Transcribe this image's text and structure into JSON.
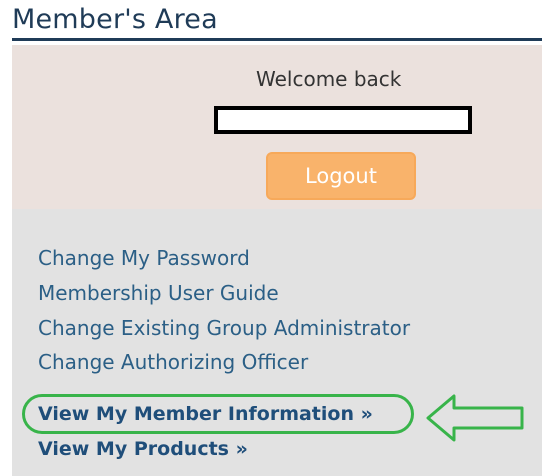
{
  "header": {
    "title": "Member's Area"
  },
  "welcome": {
    "text": "Welcome back",
    "logout_label": "Logout"
  },
  "links": [
    {
      "label": "Change My Password"
    },
    {
      "label": "Membership User Guide"
    },
    {
      "label": "Change Existing Group Administrator"
    },
    {
      "label": "Change Authorizing Officer"
    },
    {
      "label": "View My Member Information »"
    },
    {
      "label": "View My Products »"
    }
  ],
  "colors": {
    "heading": "#1f3b57",
    "welcome_bg": "#ebe1dd",
    "links_bg": "#e2e2e2",
    "logout_button": "#f9b36b",
    "link": "#2b5f86",
    "annotation": "#38b44a"
  },
  "annotation": {
    "icon": "left-arrow-outline-icon"
  }
}
